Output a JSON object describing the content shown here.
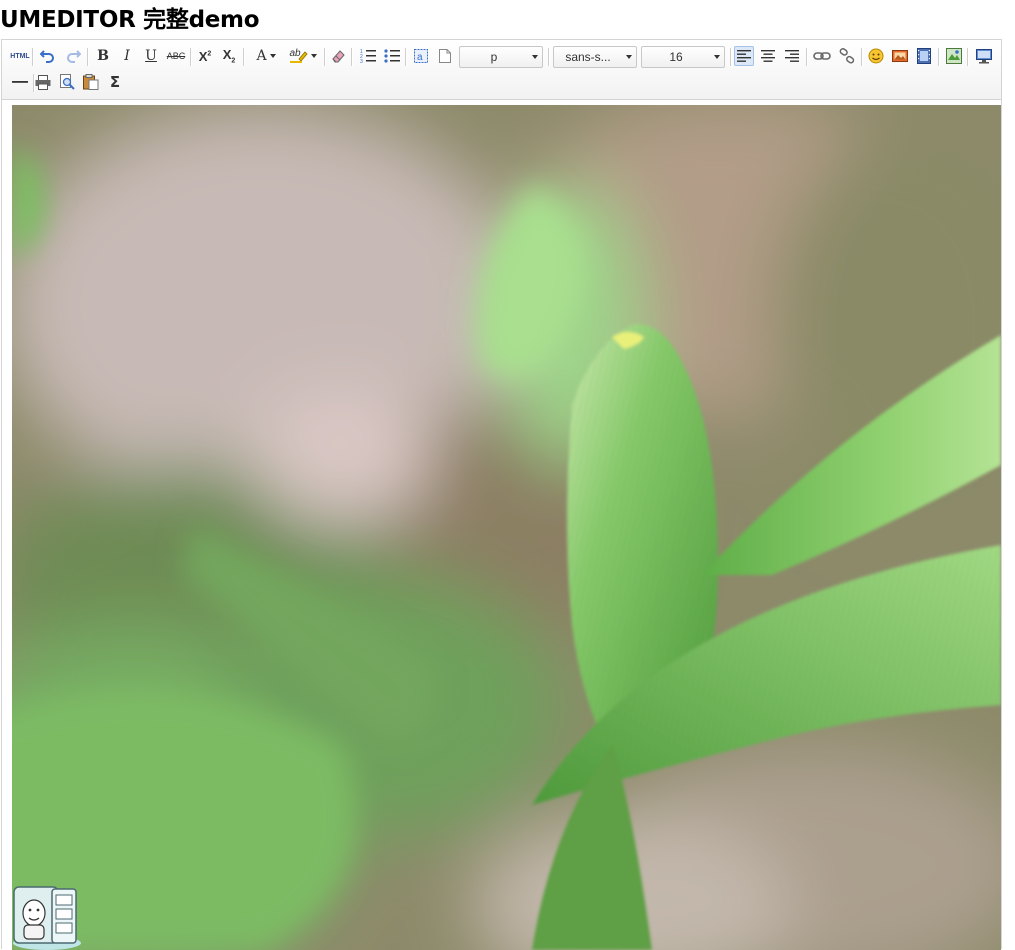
{
  "page": {
    "title": "UMEDITOR 完整demo"
  },
  "toolbar": {
    "source_label": "HTML",
    "bold": "B",
    "italic": "I",
    "underline": "U",
    "strikethrough": "ABC",
    "superscript": "X",
    "superscript_mark": "2",
    "subscript": "X",
    "subscript_mark": "2",
    "forecolor": "A",
    "backcolor": "ab",
    "paragraph": {
      "value": "p"
    },
    "font_family": {
      "value": "sans-s..."
    },
    "font_size": {
      "value": "16"
    },
    "formula": "Σ"
  },
  "colors": {
    "toolbar_bg": "#f2f2f2",
    "border": "#d4d4d4",
    "active_button_bg": "#dce8f7",
    "icon_blue": "#3a6fc7",
    "leaf_green": "#7cc464"
  },
  "icons": [
    "source-icon",
    "undo-icon",
    "redo-icon",
    "bold-icon",
    "italic-icon",
    "underline-icon",
    "strikethrough-icon",
    "superscript-icon",
    "subscript-icon",
    "font-color-icon",
    "background-color-icon",
    "eraser-icon",
    "ordered-list-icon",
    "unordered-list-icon",
    "select-all-icon",
    "clear-doc-icon",
    "align-left-icon",
    "align-center-icon",
    "align-right-icon",
    "link-icon",
    "unlink-icon",
    "emotion-icon",
    "image-icon",
    "video-icon",
    "map-icon",
    "fullscreen-icon",
    "horizontal-rule-icon",
    "print-icon",
    "preview-icon",
    "paste-icon",
    "formula-icon"
  ]
}
